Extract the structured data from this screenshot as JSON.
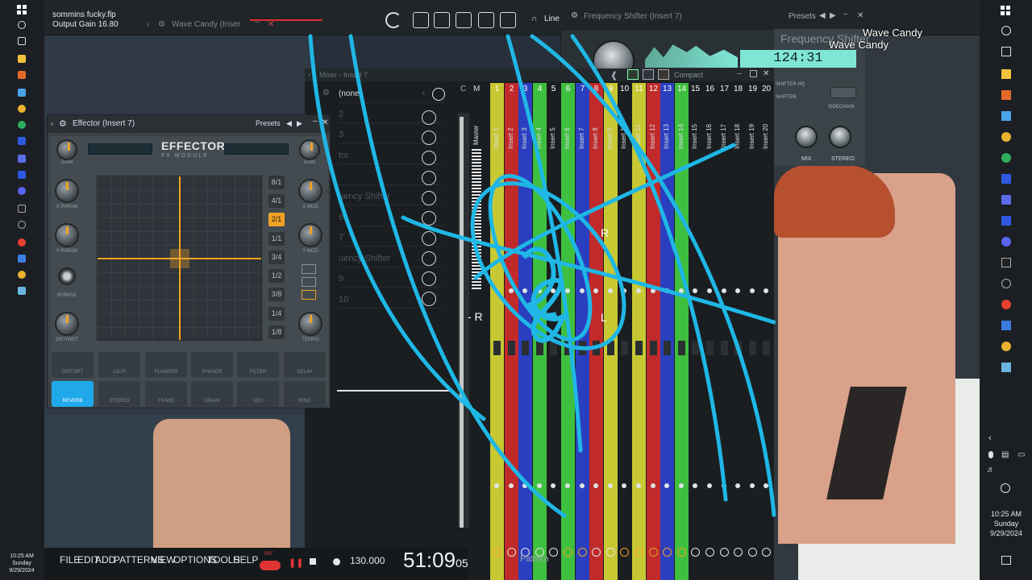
{
  "project": {
    "file_name": "sommins fucky.flp",
    "output_gain": "Output Gain 16.80",
    "insert_label": "Wave Candy (Inser"
  },
  "toolbar": {
    "line_label": "Line",
    "plugin_title": "Frequency Shifter (Insert 7)",
    "presets_label": "Presets"
  },
  "effector": {
    "title": "Effector (Insert 7)",
    "presets_label": "Presets",
    "brand": "EFFECTOR",
    "subtitle": "FX MODULE",
    "knob_labels": [
      "GAIN",
      "X PARAM",
      "Y PARAM",
      "BYPASS",
      "DRY/WET",
      "GAIN",
      "X MOD",
      "Y MOD",
      "TEMPO"
    ],
    "ratios": [
      "8/1",
      "4/1",
      "2/1",
      "1/1",
      "3/4",
      "1/2",
      "3/8",
      "1/4",
      "1/8"
    ],
    "active_ratio": "2/1",
    "effects_row1": [
      "DISTORT",
      "LO-FI",
      "FLANGER",
      "PHASER",
      "FILTER",
      "DELAY"
    ],
    "effects_row2": [
      "REVERB",
      "STEREO",
      "TRANS",
      "GRAIN",
      "VOX",
      "RING"
    ],
    "active_effect": "REVERB"
  },
  "mixer": {
    "title": "Mixer - Insert 7",
    "slot_selected": "(none)",
    "slot_ghost_1": "tor",
    "slot_ghost_2": "uency Shifter",
    "slot_ghost_3": "uency Shifter",
    "slot_ghost_nums": [
      "2",
      "3",
      "6",
      "7",
      "9",
      "10"
    ],
    "mode_label": "Compact",
    "master_label": "Master",
    "header_c": "C",
    "header_m": "M",
    "strips": [
      {
        "num": "1",
        "label": "Insert 1",
        "color": "#c8c832"
      },
      {
        "num": "2",
        "label": "Insert 2",
        "color": "#c02a2a"
      },
      {
        "num": "3",
        "label": "Insert 3",
        "color": "#2a3fbf"
      },
      {
        "num": "4",
        "label": "Insert 4",
        "color": "#3fbf3f"
      },
      {
        "num": "5",
        "label": "Insert 5",
        "color": "#1a1e21"
      },
      {
        "num": "6",
        "label": "Insert 6",
        "color": "#3fbf3f"
      },
      {
        "num": "7",
        "label": "Insert 7",
        "color": "#2a3fbf"
      },
      {
        "num": "8",
        "label": "Insert 8",
        "color": "#c02a2a"
      },
      {
        "num": "9",
        "label": "Insert 9",
        "color": "#c8c832"
      },
      {
        "num": "10",
        "label": "Insert 10",
        "color": "#1a1e21"
      },
      {
        "num": "11",
        "label": "Insert 11",
        "color": "#c8c832"
      },
      {
        "num": "12",
        "label": "Insert 12",
        "color": "#c02a2a"
      },
      {
        "num": "13",
        "label": "Insert 13",
        "color": "#2a3fbf"
      },
      {
        "num": "14",
        "label": "Insert 14",
        "color": "#3fbf3f"
      },
      {
        "num": "15",
        "label": "Insert 15",
        "color": "#1a1e21"
      },
      {
        "num": "16",
        "label": "Insert 16",
        "color": "#1a1e21"
      },
      {
        "num": "17",
        "label": "Insert 17",
        "color": "#1a1e21"
      },
      {
        "num": "18",
        "label": "Insert 18",
        "color": "#1a1e21"
      },
      {
        "num": "19",
        "label": "Insert 19",
        "color": "#1a1e21"
      },
      {
        "num": "20",
        "label": "Insert 20",
        "color": "#1a1e21"
      }
    ],
    "pan_right": "+ R",
    "pan_left": "- R",
    "pan_left2": "L"
  },
  "freq_shifter": {
    "title": "Frequency Shifter",
    "overlay_1": "Wave Candy",
    "overlay_2": "Wave Candy",
    "tempo_display": "124:31",
    "section_hq": "SHIFTER HQ",
    "section_shifter": "SHIFTER",
    "sidechain": "SIDECHAIN",
    "mix_label": "MIX",
    "stereo_label": "STEREO"
  },
  "transport": {
    "menu": [
      "FILE",
      "EDIT",
      "ADD",
      "PATTERNS",
      "VIEW",
      "OPTIONS",
      "TOOLS",
      "HELP"
    ],
    "pat_label": "PAT",
    "tempo": "130.000",
    "time_main": "51:09",
    "time_ms": "05",
    "pattern_label": "Pattern"
  },
  "taskbar_left": {
    "time": "10:25 AM",
    "day": "Sunday",
    "date": "9/29/2024"
  },
  "taskbar_right": {
    "time": "10:25 AM",
    "day": "Sunday",
    "date": "9/29/2024"
  },
  "colors": {
    "accent": "#f0a324",
    "effect_on": "#1fa9ea",
    "scribble": "#1fb7e6",
    "tempo_lcd": "#7fe6d6"
  }
}
